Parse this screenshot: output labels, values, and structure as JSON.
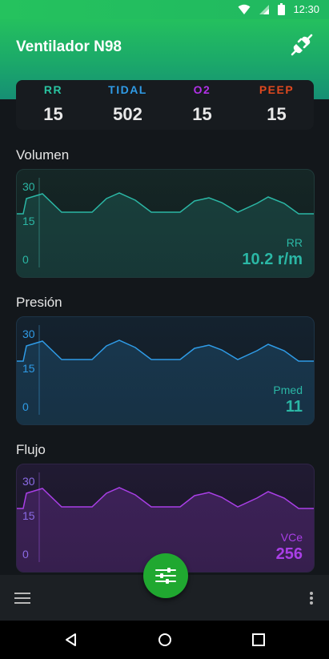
{
  "status_bar": {
    "time": "12:30",
    "icons": [
      "wifi-icon",
      "signal-icon",
      "battery-icon"
    ]
  },
  "app": {
    "title": "Ventilador N98",
    "action_icon": "plug-icon"
  },
  "vitals": [
    {
      "label": "RR",
      "value": "15",
      "color": "#29c3a0"
    },
    {
      "label": "TIDAL",
      "value": "502",
      "color": "#2f9be6"
    },
    {
      "label": "O2",
      "value": "15",
      "color": "#b231e8"
    },
    {
      "label": "PEEP",
      "value": "15",
      "color": "#e0481f"
    }
  ],
  "charts": [
    {
      "title": "Volumen",
      "color": "#2bb7a5",
      "ticks": [
        "30",
        "15",
        "0"
      ],
      "readout_label": "RR",
      "readout_value": "10.2 r/m"
    },
    {
      "title": "Presión",
      "color": "#2f9be6",
      "ticks": [
        "30",
        "15",
        "0"
      ],
      "readout_label": "Pmed",
      "readout_value": "11"
    },
    {
      "title": "Flujo",
      "color": "#a93fe6",
      "ticks": [
        "30",
        "15",
        "0"
      ],
      "readout_label": "VCe",
      "readout_value": "256"
    }
  ],
  "fab": {
    "icon": "sliders-icon"
  },
  "bottom_bar": {
    "left_icon": "menu-icon",
    "right_icon": "more-vertical-icon"
  },
  "nav": [
    "back-icon",
    "home-icon",
    "recents-icon"
  ]
}
